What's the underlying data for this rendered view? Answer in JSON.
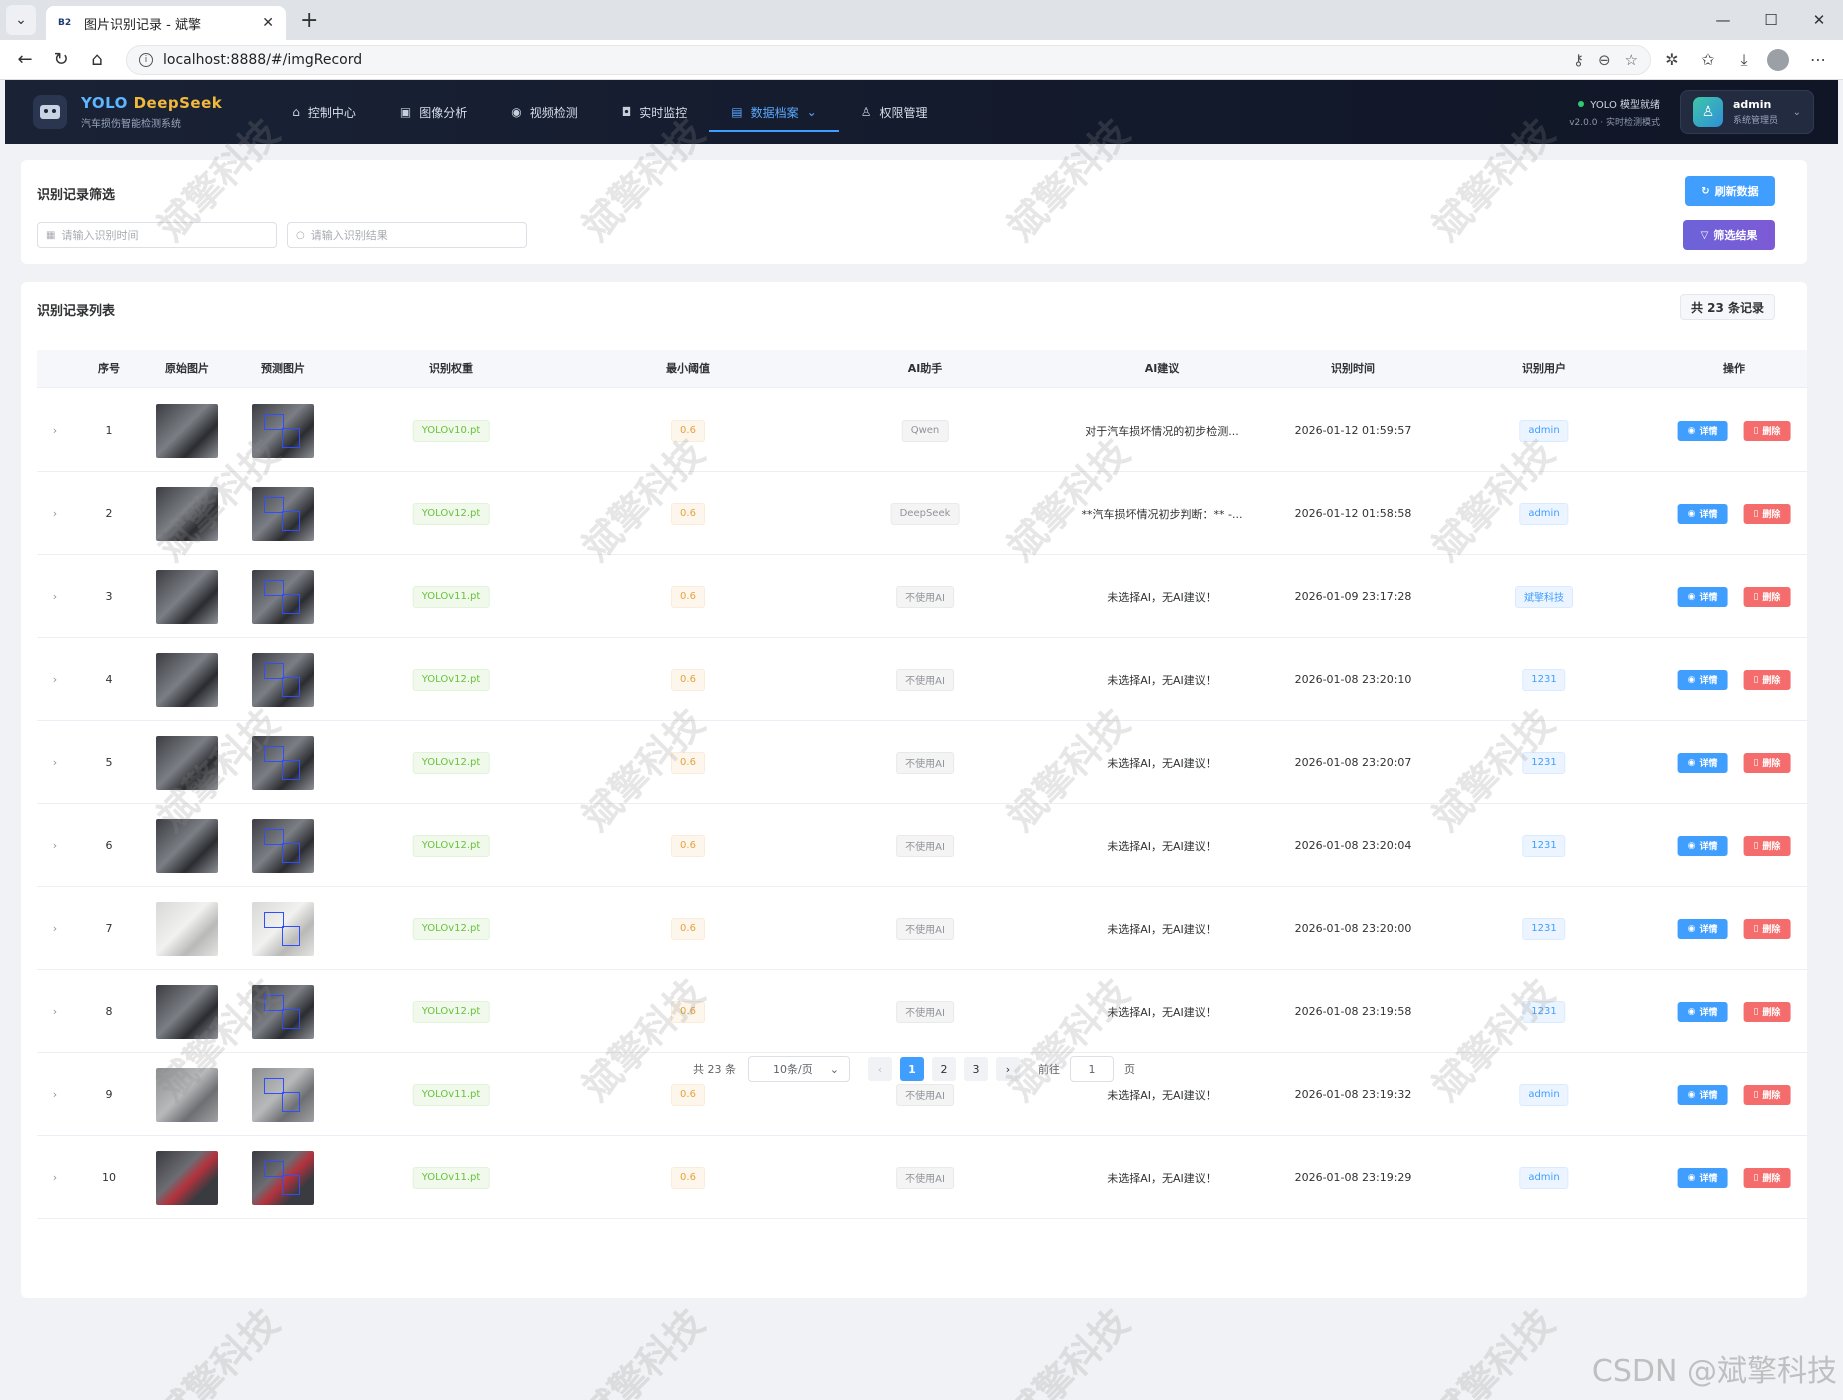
{
  "browser": {
    "tab_title": "图片识别记录 - 斌擎",
    "favicon_text": "B2",
    "url": "localhost:8888/#/imgRecord"
  },
  "header": {
    "brand_part1": "YOLO ",
    "brand_part2": "DeepSeek",
    "brand_sub": "汽车损伤智能检测系统",
    "nav": [
      {
        "label": "控制中心",
        "icon": "home-icon"
      },
      {
        "label": "图像分析",
        "icon": "image-icon"
      },
      {
        "label": "视频检测",
        "icon": "play-icon"
      },
      {
        "label": "实时监控",
        "icon": "camera-icon"
      },
      {
        "label": "数据档案",
        "icon": "document-icon",
        "active": true
      },
      {
        "label": "权限管理",
        "icon": "user-icon"
      }
    ],
    "status": "YOLO 模型就绪",
    "version": "v2.0.0 · 实时检测模式",
    "user_name": "admin",
    "user_role": "系统管理员"
  },
  "filter": {
    "title": "识别记录筛选",
    "time_placeholder": "请输入识别时间",
    "result_placeholder": "请输入识别结果",
    "refresh_label": "刷新数据",
    "filter_label": "筛选结果"
  },
  "list": {
    "title": "识别记录列表",
    "total": "共 23 条记录",
    "columns": [
      "序号",
      "原始图片",
      "预测图片",
      "识别权重",
      "最小阈值",
      "AI助手",
      "AI建议",
      "识别时间",
      "识别用户",
      "操作"
    ],
    "detail_label": "详情",
    "delete_label": "删除",
    "rows": [
      {
        "idx": "1",
        "weight": "YOLOv10.pt",
        "thr": "0.6",
        "ai": "Qwen",
        "advice": "对于汽车损坏情况的初步检测...",
        "time": "2026-01-12 01:59:57",
        "user": "admin",
        "img": "car"
      },
      {
        "idx": "2",
        "weight": "YOLOv12.pt",
        "thr": "0.6",
        "ai": "DeepSeek",
        "advice": "**汽车损坏情况初步判断：** -...",
        "time": "2026-01-12 01:58:58",
        "user": "admin",
        "img": "dark"
      },
      {
        "idx": "3",
        "weight": "YOLOv11.pt",
        "thr": "0.6",
        "ai": "不使用AI",
        "advice": "未选择AI，无AI建议！",
        "time": "2026-01-09 23:17:28",
        "user": "斌擎科技",
        "img": "dark"
      },
      {
        "idx": "4",
        "weight": "YOLOv12.pt",
        "thr": "0.6",
        "ai": "不使用AI",
        "advice": "未选择AI，无AI建议！",
        "time": "2026-01-08 23:20:10",
        "user": "1231",
        "img": "dark"
      },
      {
        "idx": "5",
        "weight": "YOLOv12.pt",
        "thr": "0.6",
        "ai": "不使用AI",
        "advice": "未选择AI，无AI建议！",
        "time": "2026-01-08 23:20:07",
        "user": "1231",
        "img": "dark"
      },
      {
        "idx": "6",
        "weight": "YOLOv12.pt",
        "thr": "0.6",
        "ai": "不使用AI",
        "advice": "未选择AI，无AI建议！",
        "time": "2026-01-08 23:20:04",
        "user": "1231",
        "img": "dark"
      },
      {
        "idx": "7",
        "weight": "YOLOv12.pt",
        "thr": "0.6",
        "ai": "不使用AI",
        "advice": "未选择AI，无AI建议！",
        "time": "2026-01-08 23:20:00",
        "user": "1231",
        "img": "light"
      },
      {
        "idx": "8",
        "weight": "YOLOv12.pt",
        "thr": "0.6",
        "ai": "不使用AI",
        "advice": "未选择AI，无AI建议！",
        "time": "2026-01-08 23:19:58",
        "user": "1231",
        "img": "dark"
      },
      {
        "idx": "9",
        "weight": "YOLOv11.pt",
        "thr": "0.6",
        "ai": "不使用AI",
        "advice": "未选择AI，无AI建议！",
        "time": "2026-01-08 23:19:32",
        "user": "admin",
        "img": "grey"
      },
      {
        "idx": "10",
        "weight": "YOLOv11.pt",
        "thr": "0.6",
        "ai": "不使用AI",
        "advice": "未选择AI，无AI建议！",
        "time": "2026-01-08 23:19:29",
        "user": "admin",
        "img": "red"
      }
    ]
  },
  "pager": {
    "total": "共 23 条",
    "size": "10条/页",
    "pages": [
      "1",
      "2",
      "3"
    ],
    "goto": "前往",
    "current": "1",
    "page_unit": "页"
  },
  "watermark": "斌擎科技",
  "csdn": "CSDN @斌擎科技"
}
